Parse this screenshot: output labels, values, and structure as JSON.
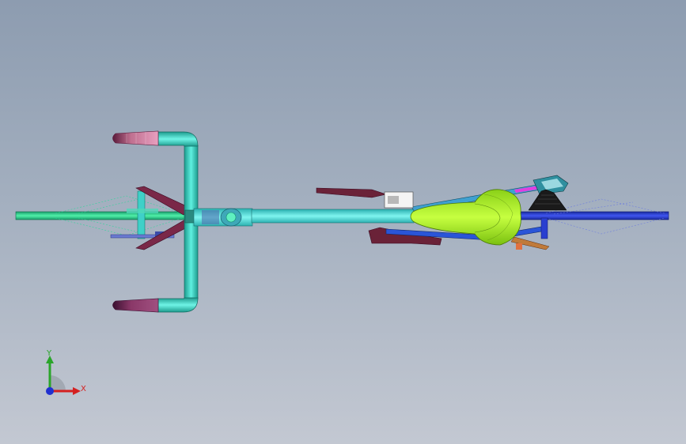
{
  "viewport": {
    "background_top": "#8d9cb0",
    "background_bottom": "#c3c8d2"
  },
  "model": {
    "view": "top",
    "parts": [
      {
        "name": "front-wheel",
        "color": "#2fd08a"
      },
      {
        "name": "rear-wheel",
        "color": "#2a3fd0"
      },
      {
        "name": "handlebar",
        "color": "#3fd0c8"
      },
      {
        "name": "top-tube",
        "color": "#5fe6e0"
      },
      {
        "name": "saddle",
        "color": "#a8f020"
      },
      {
        "name": "seat-stays",
        "color": "#2a55d8"
      },
      {
        "name": "bar-grips",
        "color": "#e88fb0"
      },
      {
        "name": "crank-arms",
        "color": "#7a2848"
      },
      {
        "name": "rear-derailleur",
        "color": "#30b0c0"
      },
      {
        "name": "cassette",
        "color": "#1a1a1a"
      }
    ]
  },
  "triad": {
    "y_label": "Y",
    "x_label": "X",
    "y_color": "#2aa52a",
    "x_color": "#d42020",
    "z_color": "#2030d0"
  }
}
